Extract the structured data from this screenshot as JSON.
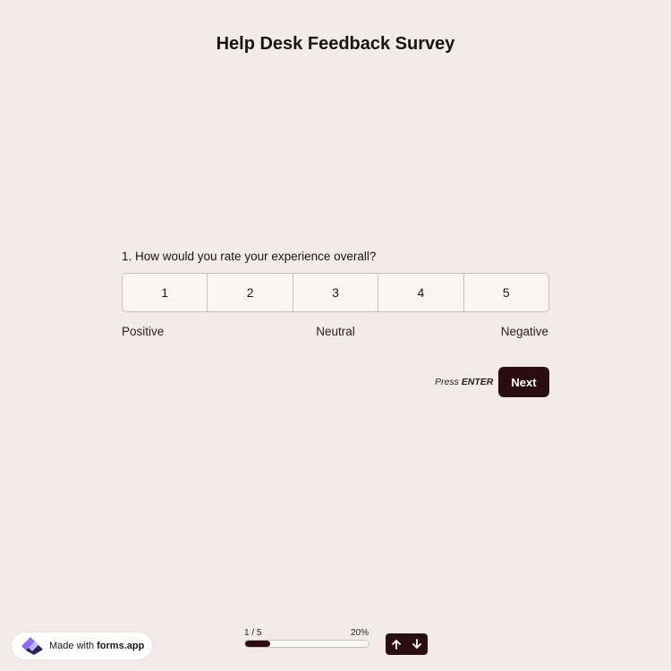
{
  "survey": {
    "title": "Help Desk Feedback Survey"
  },
  "question": {
    "text": "1.  How would you rate your experience overall?",
    "options": [
      "1",
      "2",
      "3",
      "4",
      "5"
    ],
    "labels": {
      "left": "Positive",
      "middle": "Neutral",
      "right": "Negative"
    }
  },
  "actions": {
    "press_prefix": "Press ",
    "press_key": "ENTER",
    "next_label": "Next"
  },
  "progress": {
    "count": "1 / 5",
    "percent_label": "20%",
    "fraction": 0.2
  },
  "footer": {
    "made_with": "Made with",
    "brand": "forms.app"
  },
  "icons": {
    "up": "arrow-up-icon",
    "down": "arrow-down-icon",
    "logo": "forms-app-logo-icon"
  },
  "colors": {
    "background": "#f3eaea",
    "accent": "#2a0e10"
  }
}
